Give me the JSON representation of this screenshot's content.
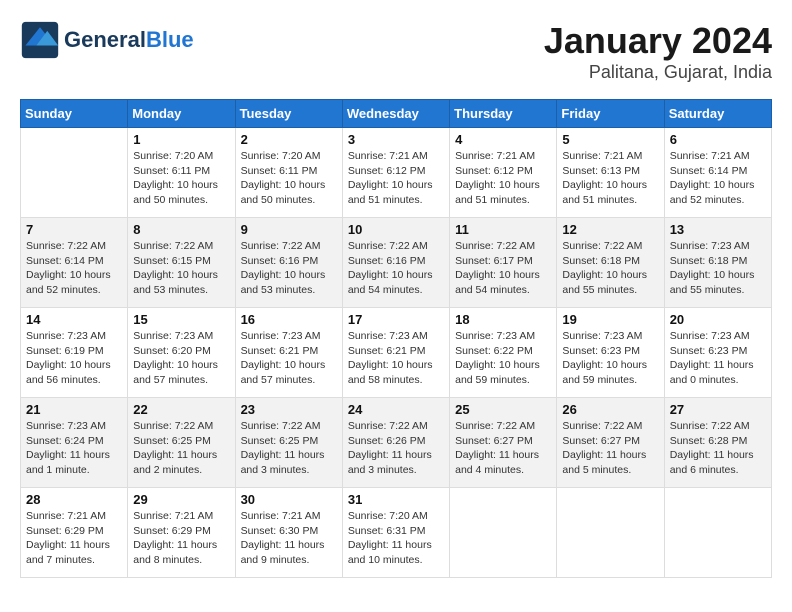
{
  "header": {
    "logo_general": "General",
    "logo_blue": "Blue",
    "title": "January 2024",
    "subtitle": "Palitana, Gujarat, India"
  },
  "columns": [
    "Sunday",
    "Monday",
    "Tuesday",
    "Wednesday",
    "Thursday",
    "Friday",
    "Saturday"
  ],
  "weeks": [
    [
      {
        "day": "",
        "info": ""
      },
      {
        "day": "1",
        "info": "Sunrise: 7:20 AM\nSunset: 6:11 PM\nDaylight: 10 hours\nand 50 minutes."
      },
      {
        "day": "2",
        "info": "Sunrise: 7:20 AM\nSunset: 6:11 PM\nDaylight: 10 hours\nand 50 minutes."
      },
      {
        "day": "3",
        "info": "Sunrise: 7:21 AM\nSunset: 6:12 PM\nDaylight: 10 hours\nand 51 minutes."
      },
      {
        "day": "4",
        "info": "Sunrise: 7:21 AM\nSunset: 6:12 PM\nDaylight: 10 hours\nand 51 minutes."
      },
      {
        "day": "5",
        "info": "Sunrise: 7:21 AM\nSunset: 6:13 PM\nDaylight: 10 hours\nand 51 minutes."
      },
      {
        "day": "6",
        "info": "Sunrise: 7:21 AM\nSunset: 6:14 PM\nDaylight: 10 hours\nand 52 minutes."
      }
    ],
    [
      {
        "day": "7",
        "info": "Sunrise: 7:22 AM\nSunset: 6:14 PM\nDaylight: 10 hours\nand 52 minutes."
      },
      {
        "day": "8",
        "info": "Sunrise: 7:22 AM\nSunset: 6:15 PM\nDaylight: 10 hours\nand 53 minutes."
      },
      {
        "day": "9",
        "info": "Sunrise: 7:22 AM\nSunset: 6:16 PM\nDaylight: 10 hours\nand 53 minutes."
      },
      {
        "day": "10",
        "info": "Sunrise: 7:22 AM\nSunset: 6:16 PM\nDaylight: 10 hours\nand 54 minutes."
      },
      {
        "day": "11",
        "info": "Sunrise: 7:22 AM\nSunset: 6:17 PM\nDaylight: 10 hours\nand 54 minutes."
      },
      {
        "day": "12",
        "info": "Sunrise: 7:22 AM\nSunset: 6:18 PM\nDaylight: 10 hours\nand 55 minutes."
      },
      {
        "day": "13",
        "info": "Sunrise: 7:23 AM\nSunset: 6:18 PM\nDaylight: 10 hours\nand 55 minutes."
      }
    ],
    [
      {
        "day": "14",
        "info": "Sunrise: 7:23 AM\nSunset: 6:19 PM\nDaylight: 10 hours\nand 56 minutes."
      },
      {
        "day": "15",
        "info": "Sunrise: 7:23 AM\nSunset: 6:20 PM\nDaylight: 10 hours\nand 57 minutes."
      },
      {
        "day": "16",
        "info": "Sunrise: 7:23 AM\nSunset: 6:21 PM\nDaylight: 10 hours\nand 57 minutes."
      },
      {
        "day": "17",
        "info": "Sunrise: 7:23 AM\nSunset: 6:21 PM\nDaylight: 10 hours\nand 58 minutes."
      },
      {
        "day": "18",
        "info": "Sunrise: 7:23 AM\nSunset: 6:22 PM\nDaylight: 10 hours\nand 59 minutes."
      },
      {
        "day": "19",
        "info": "Sunrise: 7:23 AM\nSunset: 6:23 PM\nDaylight: 10 hours\nand 59 minutes."
      },
      {
        "day": "20",
        "info": "Sunrise: 7:23 AM\nSunset: 6:23 PM\nDaylight: 11 hours\nand 0 minutes."
      }
    ],
    [
      {
        "day": "21",
        "info": "Sunrise: 7:23 AM\nSunset: 6:24 PM\nDaylight: 11 hours\nand 1 minute."
      },
      {
        "day": "22",
        "info": "Sunrise: 7:22 AM\nSunset: 6:25 PM\nDaylight: 11 hours\nand 2 minutes."
      },
      {
        "day": "23",
        "info": "Sunrise: 7:22 AM\nSunset: 6:25 PM\nDaylight: 11 hours\nand 3 minutes."
      },
      {
        "day": "24",
        "info": "Sunrise: 7:22 AM\nSunset: 6:26 PM\nDaylight: 11 hours\nand 3 minutes."
      },
      {
        "day": "25",
        "info": "Sunrise: 7:22 AM\nSunset: 6:27 PM\nDaylight: 11 hours\nand 4 minutes."
      },
      {
        "day": "26",
        "info": "Sunrise: 7:22 AM\nSunset: 6:27 PM\nDaylight: 11 hours\nand 5 minutes."
      },
      {
        "day": "27",
        "info": "Sunrise: 7:22 AM\nSunset: 6:28 PM\nDaylight: 11 hours\nand 6 minutes."
      }
    ],
    [
      {
        "day": "28",
        "info": "Sunrise: 7:21 AM\nSunset: 6:29 PM\nDaylight: 11 hours\nand 7 minutes."
      },
      {
        "day": "29",
        "info": "Sunrise: 7:21 AM\nSunset: 6:29 PM\nDaylight: 11 hours\nand 8 minutes."
      },
      {
        "day": "30",
        "info": "Sunrise: 7:21 AM\nSunset: 6:30 PM\nDaylight: 11 hours\nand 9 minutes."
      },
      {
        "day": "31",
        "info": "Sunrise: 7:20 AM\nSunset: 6:31 PM\nDaylight: 11 hours\nand 10 minutes."
      },
      {
        "day": "",
        "info": ""
      },
      {
        "day": "",
        "info": ""
      },
      {
        "day": "",
        "info": ""
      }
    ]
  ]
}
